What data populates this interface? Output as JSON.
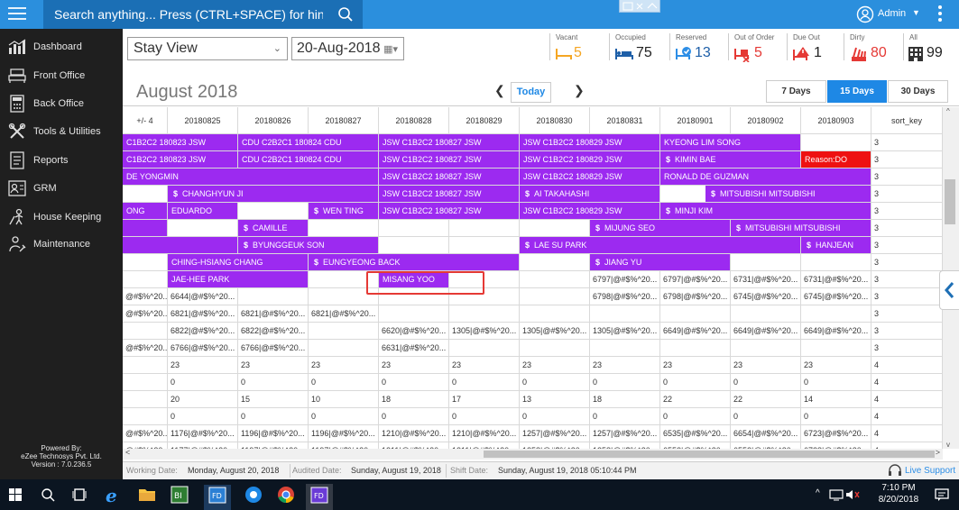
{
  "topbar": {
    "search_placeholder": "Search anything... Press (CTRL+SPACE) for hint",
    "user_name": "Admin",
    "colors": {
      "bar": "#2b8fdd",
      "search": "#1b6fb5"
    }
  },
  "sidebar": {
    "items": [
      {
        "label": "Dashboard",
        "icon": "bar-chart-icon"
      },
      {
        "label": "Front Office",
        "icon": "bed-icon"
      },
      {
        "label": "Back Office",
        "icon": "calculator-icon"
      },
      {
        "label": "Tools & Utilities",
        "icon": "tools-icon"
      },
      {
        "label": "Reports",
        "icon": "report-icon"
      },
      {
        "label": "GRM",
        "icon": "grm-icon"
      },
      {
        "label": "House Keeping",
        "icon": "housekeeping-icon"
      },
      {
        "label": "Maintenance",
        "icon": "maintenance-icon"
      }
    ],
    "powered_by": "Powered By:",
    "company": "eZee Technosys Pvt. Ltd.",
    "version": "Version : 7.0.236.5"
  },
  "toolbar": {
    "view_selected": "Stay View",
    "date_value": "20-Aug-2018"
  },
  "stats": [
    {
      "label": "Vacant",
      "value": "5",
      "icon": "vacant-bed-icon",
      "color": "#f5a623"
    },
    {
      "label": "Occupied",
      "value": "75",
      "icon": "occupied-bed-icon",
      "color": "#1e5fa8"
    },
    {
      "label": "Reserved",
      "value": "13",
      "icon": "reserved-icon",
      "color": "#2d8ee6"
    },
    {
      "label": "Out of Order",
      "value": "5",
      "icon": "out-of-order-icon",
      "color": "#e53935"
    },
    {
      "label": "Due Out",
      "value": "1",
      "icon": "due-out-icon",
      "color": "#e53935"
    },
    {
      "label": "Dirty",
      "value": "80",
      "icon": "dirty-icon",
      "color": "#e53935"
    },
    {
      "label": "All",
      "value": "99",
      "icon": "building-icon",
      "color": "#333333"
    }
  ],
  "calendar": {
    "month": "August 2018",
    "today_label": "Today",
    "range_options": [
      "7 Days",
      "15 Days",
      "30 Days"
    ],
    "selected_range": "15 Days",
    "columns": [
      "+/- 4",
      "20180825",
      "20180826",
      "20180827",
      "20180828",
      "20180829",
      "20180830",
      "20180831",
      "20180901",
      "20180902",
      "20180903",
      "sort_key"
    ],
    "sort_keys": [
      "3",
      "3",
      "3",
      "3",
      "3",
      "3",
      "3",
      "3",
      "3",
      "3",
      "3",
      "3",
      "3",
      "4",
      "4",
      "4",
      "4",
      "4",
      "4"
    ],
    "bars": [
      {
        "row": 0,
        "start": 0,
        "span": 2,
        "label": "C1B2C2 180823 JSW"
      },
      {
        "row": 0,
        "start": 2,
        "span": 2,
        "label": "CDU C2B2C1 180824 CDU"
      },
      {
        "row": 0,
        "start": 4,
        "span": 2,
        "label": "JSW C1B2C2 180827 JSW"
      },
      {
        "row": 0,
        "start": 6,
        "span": 2,
        "label": "JSW C1B2C2 180829 JSW"
      },
      {
        "row": 0,
        "start": 8,
        "span": 2,
        "label": "KYEONG LIM SONG"
      },
      {
        "row": 1,
        "start": 0,
        "span": 2,
        "label": "C1B2C2 180823 JSW"
      },
      {
        "row": 1,
        "start": 2,
        "span": 2,
        "label": "CDU C2B2C1 180824 CDU"
      },
      {
        "row": 1,
        "start": 4,
        "span": 2,
        "label": "JSW C1B2C2 180827 JSW"
      },
      {
        "row": 1,
        "start": 6,
        "span": 2,
        "label": "JSW C1B2C2 180829 JSW"
      },
      {
        "row": 1,
        "start": 8,
        "span": 2,
        "label": "KIMIN BAE",
        "dollar": true
      },
      {
        "row": 1,
        "start": 10,
        "span": 1,
        "label": "Reason:DO",
        "red": true
      },
      {
        "row": 2,
        "start": 0,
        "span": 4,
        "label": "DE YONGMIN"
      },
      {
        "row": 2,
        "start": 4,
        "span": 2,
        "label": "JSW C1B2C2 180827 JSW"
      },
      {
        "row": 2,
        "start": 6,
        "span": 2,
        "label": "JSW C1B2C2 180829 JSW"
      },
      {
        "row": 2,
        "start": 8,
        "span": 3,
        "label": "RONALD DE GUZMAN"
      },
      {
        "row": 3,
        "start": 0,
        "span": 4,
        "label": "CHANGHYUN JI",
        "dollar": true,
        "offset": 1
      },
      {
        "row": 3,
        "start": 4,
        "span": 2,
        "label": "JSW C1B2C2 180827 JSW"
      },
      {
        "row": 3,
        "start": 6,
        "span": 2,
        "label": "AI TAKAHASHI",
        "dollar": true
      },
      {
        "row": 3,
        "start": 8,
        "span": 3,
        "label": "MITSUBISHI MITSUBISHI",
        "dollar": true,
        "offset": 1
      },
      {
        "row": 4,
        "start": 0,
        "span": 1,
        "label": "ONG"
      },
      {
        "row": 4,
        "start": 1,
        "span": 1,
        "label": "EDUARDO"
      },
      {
        "row": 4,
        "start": 3,
        "span": 1,
        "label": "WEN TING",
        "dollar": true
      },
      {
        "row": 4,
        "start": 4,
        "span": 2,
        "label": "JSW C1B2C2 180827 JSW"
      },
      {
        "row": 4,
        "start": 6,
        "span": 2,
        "label": "JSW C1B2C2 180829 JSW"
      },
      {
        "row": 4,
        "start": 8,
        "span": 3,
        "label": "MINJI KIM",
        "dollar": true
      },
      {
        "row": 5,
        "start": 0,
        "span": 1,
        "label": ""
      },
      {
        "row": 5,
        "start": 2,
        "span": 1,
        "label": "CAMILLE",
        "dollar": true
      },
      {
        "row": 5,
        "start": 7,
        "span": 2,
        "label": "MIJUNG SEO",
        "dollar": true
      },
      {
        "row": 5,
        "start": 9,
        "span": 2,
        "label": "MITSUBISHI MITSUBISHI",
        "dollar": true
      },
      {
        "row": 6,
        "start": 0,
        "span": 2,
        "label": ""
      },
      {
        "row": 6,
        "start": 2,
        "span": 2,
        "label": "BYUNGGEUK SON",
        "dollar": true
      },
      {
        "row": 6,
        "start": 6,
        "span": 4,
        "label": "LAE SU PARK",
        "dollar": true
      },
      {
        "row": 6,
        "start": 10,
        "span": 1,
        "label": "HANJEAN",
        "dollar": true
      },
      {
        "row": 7,
        "start": 1,
        "span": 2,
        "label": "CHING-HSIANG CHANG"
      },
      {
        "row": 7,
        "start": 3,
        "span": 3,
        "label": "EUNGYEONG BACK",
        "dollar": true
      },
      {
        "row": 7,
        "start": 7,
        "span": 2,
        "label": "JIANG YU",
        "dollar": true
      },
      {
        "row": 8,
        "start": 1,
        "span": 2,
        "label": "JAE-HEE PARK"
      },
      {
        "row": 8,
        "start": 4,
        "span": 1,
        "label": "MISANG YOO"
      }
    ],
    "cells": [
      {
        "row": 8,
        "col": 7,
        "text": "6797|@#$%^20..."
      },
      {
        "row": 8,
        "col": 8,
        "text": "6797|@#$%^20..."
      },
      {
        "row": 8,
        "col": 9,
        "text": "6731|@#$%^20..."
      },
      {
        "row": 8,
        "col": 10,
        "text": "6731|@#$%^20..."
      },
      {
        "row": 9,
        "col": 0,
        "text": "@#$%^20..."
      },
      {
        "row": 9,
        "col": 1,
        "text": "6644|@#$%^20..."
      },
      {
        "row": 9,
        "col": 7,
        "text": "6798|@#$%^20..."
      },
      {
        "row": 9,
        "col": 8,
        "text": "6798|@#$%^20..."
      },
      {
        "row": 9,
        "col": 9,
        "text": "6745|@#$%^20..."
      },
      {
        "row": 9,
        "col": 10,
        "text": "6745|@#$%^20..."
      },
      {
        "row": 10,
        "col": 0,
        "text": "@#$%^20..."
      },
      {
        "row": 10,
        "col": 1,
        "text": "6821|@#$%^20..."
      },
      {
        "row": 10,
        "col": 2,
        "text": "6821|@#$%^20..."
      },
      {
        "row": 10,
        "col": 3,
        "text": "6821|@#$%^20..."
      },
      {
        "row": 11,
        "col": 1,
        "text": "6822|@#$%^20..."
      },
      {
        "row": 11,
        "col": 2,
        "text": "6822|@#$%^20..."
      },
      {
        "row": 11,
        "col": 4,
        "text": "6620|@#$%^20..."
      },
      {
        "row": 11,
        "col": 5,
        "text": "1305|@#$%^20..."
      },
      {
        "row": 11,
        "col": 6,
        "text": "1305|@#$%^20..."
      },
      {
        "row": 11,
        "col": 7,
        "text": "1305|@#$%^20..."
      },
      {
        "row": 11,
        "col": 8,
        "text": "6649|@#$%^20..."
      },
      {
        "row": 11,
        "col": 9,
        "text": "6649|@#$%^20..."
      },
      {
        "row": 11,
        "col": 10,
        "text": "6649|@#$%^20..."
      },
      {
        "row": 12,
        "col": 0,
        "text": "@#$%^20..."
      },
      {
        "row": 12,
        "col": 1,
        "text": "6766|@#$%^20..."
      },
      {
        "row": 12,
        "col": 2,
        "text": "6766|@#$%^20..."
      },
      {
        "row": 12,
        "col": 4,
        "text": "6631|@#$%^20..."
      },
      {
        "row": 13,
        "col": 1,
        "text": "23"
      },
      {
        "row": 13,
        "col": 2,
        "text": "23"
      },
      {
        "row": 13,
        "col": 3,
        "text": "23"
      },
      {
        "row": 13,
        "col": 4,
        "text": "23"
      },
      {
        "row": 13,
        "col": 5,
        "text": "23"
      },
      {
        "row": 13,
        "col": 6,
        "text": "23"
      },
      {
        "row": 13,
        "col": 7,
        "text": "23"
      },
      {
        "row": 13,
        "col": 8,
        "text": "23"
      },
      {
        "row": 13,
        "col": 9,
        "text": "23"
      },
      {
        "row": 13,
        "col": 10,
        "text": "23"
      },
      {
        "row": 14,
        "col": 1,
        "text": "0"
      },
      {
        "row": 14,
        "col": 2,
        "text": "0"
      },
      {
        "row": 14,
        "col": 3,
        "text": "0"
      },
      {
        "row": 14,
        "col": 4,
        "text": "0"
      },
      {
        "row": 14,
        "col": 5,
        "text": "0"
      },
      {
        "row": 14,
        "col": 6,
        "text": "0"
      },
      {
        "row": 14,
        "col": 7,
        "text": "0"
      },
      {
        "row": 14,
        "col": 8,
        "text": "0"
      },
      {
        "row": 14,
        "col": 9,
        "text": "0"
      },
      {
        "row": 14,
        "col": 10,
        "text": "0"
      },
      {
        "row": 15,
        "col": 1,
        "text": "20"
      },
      {
        "row": 15,
        "col": 2,
        "text": "15"
      },
      {
        "row": 15,
        "col": 3,
        "text": "10"
      },
      {
        "row": 15,
        "col": 4,
        "text": "18"
      },
      {
        "row": 15,
        "col": 5,
        "text": "17"
      },
      {
        "row": 15,
        "col": 6,
        "text": "13"
      },
      {
        "row": 15,
        "col": 7,
        "text": "18"
      },
      {
        "row": 15,
        "col": 8,
        "text": "22"
      },
      {
        "row": 15,
        "col": 9,
        "text": "22"
      },
      {
        "row": 15,
        "col": 10,
        "text": "14"
      },
      {
        "row": 16,
        "col": 1,
        "text": "0"
      },
      {
        "row": 16,
        "col": 2,
        "text": "0"
      },
      {
        "row": 16,
        "col": 3,
        "text": "0"
      },
      {
        "row": 16,
        "col": 4,
        "text": "0"
      },
      {
        "row": 16,
        "col": 5,
        "text": "0"
      },
      {
        "row": 16,
        "col": 6,
        "text": "0"
      },
      {
        "row": 16,
        "col": 7,
        "text": "0"
      },
      {
        "row": 16,
        "col": 8,
        "text": "0"
      },
      {
        "row": 16,
        "col": 9,
        "text": "0"
      },
      {
        "row": 16,
        "col": 10,
        "text": "0"
      },
      {
        "row": 17,
        "col": 0,
        "text": "@#$%^20..."
      },
      {
        "row": 17,
        "col": 1,
        "text": "1176|@#$%^20..."
      },
      {
        "row": 17,
        "col": 2,
        "text": "1196|@#$%^20..."
      },
      {
        "row": 17,
        "col": 3,
        "text": "1196|@#$%^20..."
      },
      {
        "row": 17,
        "col": 4,
        "text": "1210|@#$%^20..."
      },
      {
        "row": 17,
        "col": 5,
        "text": "1210|@#$%^20..."
      },
      {
        "row": 17,
        "col": 6,
        "text": "1257|@#$%^20..."
      },
      {
        "row": 17,
        "col": 7,
        "text": "1257|@#$%^20..."
      },
      {
        "row": 17,
        "col": 8,
        "text": "6535|@#$%^20..."
      },
      {
        "row": 17,
        "col": 9,
        "text": "6654|@#$%^20..."
      },
      {
        "row": 17,
        "col": 10,
        "text": "6723|@#$%^20..."
      },
      {
        "row": 18,
        "col": 0,
        "text": "@#$%^20..."
      },
      {
        "row": 18,
        "col": 1,
        "text": "1177|@#$%^20..."
      },
      {
        "row": 18,
        "col": 2,
        "text": "1197|@#$%^20..."
      },
      {
        "row": 18,
        "col": 3,
        "text": "1197|@#$%^20..."
      },
      {
        "row": 18,
        "col": 4,
        "text": "1211|@#$%^20..."
      },
      {
        "row": 18,
        "col": 5,
        "text": "1211|@#$%^20..."
      },
      {
        "row": 18,
        "col": 6,
        "text": "1258|@#$%^20..."
      },
      {
        "row": 18,
        "col": 7,
        "text": "1258|@#$%^20..."
      },
      {
        "row": 18,
        "col": 8,
        "text": "6552|@#$%^20..."
      },
      {
        "row": 18,
        "col": 9,
        "text": "6552|@#$%^20..."
      },
      {
        "row": 18,
        "col": 10,
        "text": "6728|@#$%^20..."
      }
    ],
    "bar_color": "#9c2af0",
    "blocked_color": "#ee1111"
  },
  "statusbar": {
    "working_label": "Working Date:",
    "working_value": "Monday, August 20, 2018",
    "audited_label": "Audited Date:",
    "audited_value": "Sunday, August 19, 2018",
    "shift_label": "Shift Date:",
    "shift_value": "Sunday, August 19, 2018 05:10:44 PM",
    "live_support": "Live Support"
  },
  "taskbar": {
    "time": "7:10 PM",
    "date": "8/20/2018"
  }
}
